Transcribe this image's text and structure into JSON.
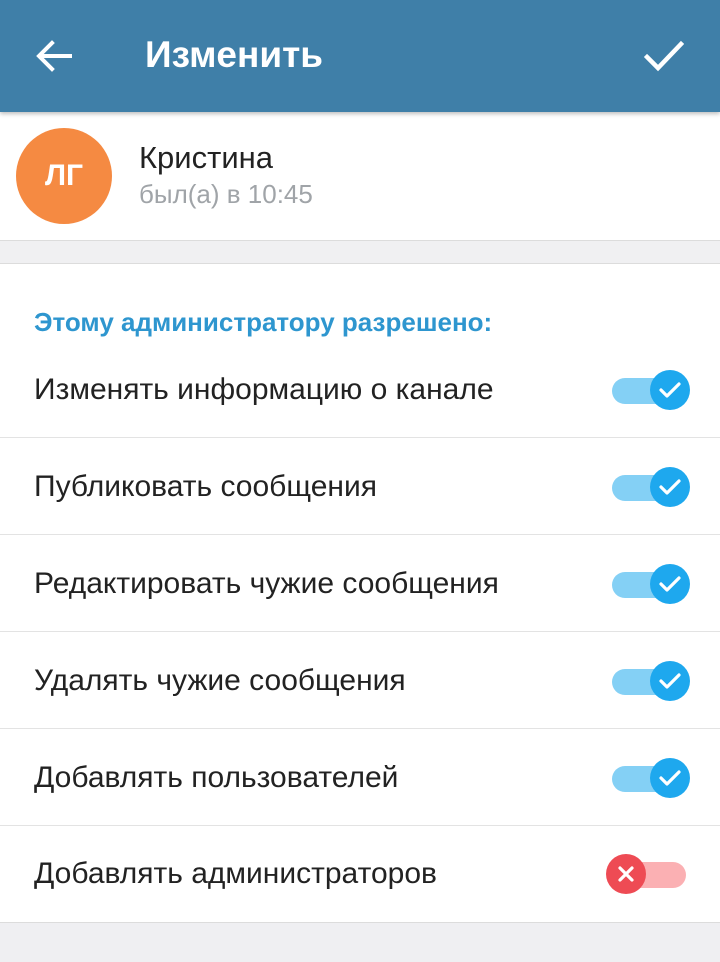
{
  "appbar": {
    "title": "Изменить",
    "back_icon": "arrow-left-icon",
    "done_icon": "checkmark-icon",
    "color": "#3f7fa8"
  },
  "profile": {
    "initials": "ЛГ",
    "name": "Кристина",
    "status": "был(а) в 10:45",
    "avatar_color": "#f58a42"
  },
  "permissions": {
    "header": "Этому администратору разрешено:",
    "header_color": "#2e96cf",
    "items": [
      {
        "label": "Изменять информацию о канале",
        "enabled": true
      },
      {
        "label": "Публиковать сообщения",
        "enabled": true
      },
      {
        "label": "Редактировать чужие сообщения",
        "enabled": true
      },
      {
        "label": "Удалять чужие сообщения",
        "enabled": true
      },
      {
        "label": "Добавлять пользователей",
        "enabled": true
      },
      {
        "label": "Добавлять администраторов",
        "enabled": false
      }
    ],
    "on_color": "#1ea8ee",
    "off_color": "#ee4b54"
  }
}
